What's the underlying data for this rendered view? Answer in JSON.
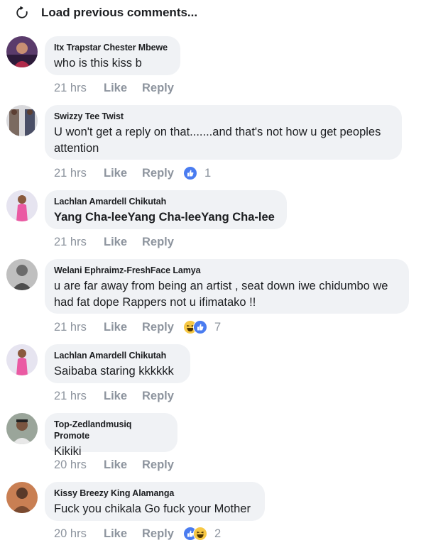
{
  "load_previous": {
    "label": "Load previous comments..."
  },
  "comments": [
    {
      "author": "Itx Trapstar Chester Mbewe",
      "text": "who is this kiss b",
      "time": "21 hrs",
      "like": "Like",
      "reply": "Reply",
      "reactions": [],
      "reaction_count": ""
    },
    {
      "author": "Swizzy Tee Twist",
      "text": "U won't get a  reply on that.......and that's not how u get peoples attention",
      "time": "21 hrs",
      "like": "Like",
      "reply": "Reply",
      "reactions": [
        "like-icon"
      ],
      "reaction_count": "1"
    },
    {
      "author": "Lachlan Amardell Chikutah",
      "text": "Yang Cha-leeYang Cha-leeYang Cha-lee",
      "time": "21 hrs",
      "like": "Like",
      "reply": "Reply",
      "reactions": [],
      "reaction_count": ""
    },
    {
      "author": "Welani Ephraimz-FreshFace Lamya",
      "text": "u are far away from being an artist , seat down iwe chidumbo we had fat dope Rappers not u ifimatako !!",
      "time": "21 hrs",
      "like": "Like",
      "reply": "Reply",
      "reactions": [
        "haha-icon",
        "like-icon"
      ],
      "reaction_count": "7"
    },
    {
      "author": "Lachlan Amardell Chikutah",
      "text": "Saibaba staring kkkkkk",
      "time": "21 hrs",
      "like": "Like",
      "reply": "Reply",
      "reactions": [],
      "reaction_count": ""
    },
    {
      "author": "Top-Zedlandmusiq Promote",
      "text": "Kikiki",
      "time": "20 hrs",
      "like": "Like",
      "reply": "Reply",
      "reactions": [],
      "reaction_count": ""
    },
    {
      "author": "Kissy Breezy King Alamanga",
      "text": "Fuck you chikala Go fuck your Mother",
      "time": "20 hrs",
      "like": "Like",
      "reply": "Reply",
      "reactions": [
        "like-icon",
        "haha-icon"
      ],
      "reaction_count": "2"
    }
  ],
  "colors": {
    "like_blue": "#4a7cf0",
    "haha_yellow": "#f7c844",
    "meta_gray": "#8d949e",
    "bubble_bg": "#f0f2f5"
  }
}
